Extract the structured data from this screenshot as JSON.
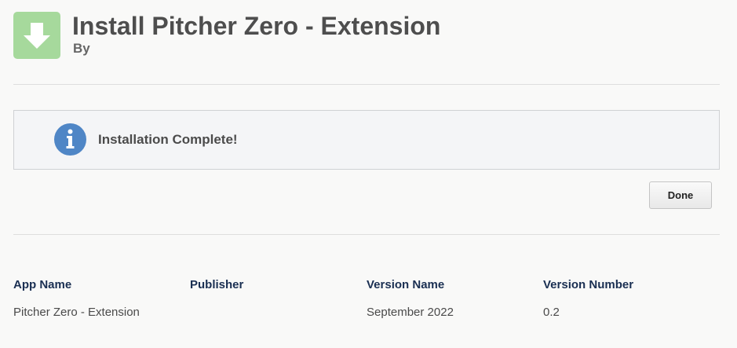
{
  "header": {
    "icon": "download-arrow-icon",
    "icon_color": "#a6d99c",
    "title": "Install Pitcher Zero - Extension",
    "subtitle": "By"
  },
  "message": {
    "icon": "info-icon",
    "icon_color": "#4f86c6",
    "text": "Installation Complete!"
  },
  "actions": {
    "done_label": "Done"
  },
  "details": {
    "columns": [
      {
        "header": "App Name",
        "value": "Pitcher Zero - Extension"
      },
      {
        "header": "Publisher",
        "value": ""
      },
      {
        "header": "Version Name",
        "value": "September 2022"
      },
      {
        "header": "Version Number",
        "value": "0.2"
      }
    ]
  }
}
